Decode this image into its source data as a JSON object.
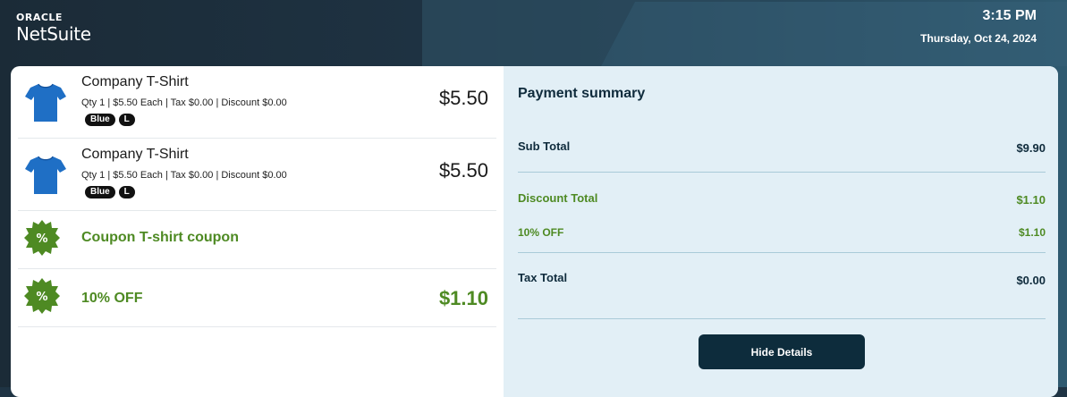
{
  "header": {
    "brand_top": "ORACLE",
    "brand_name": "NetSuite",
    "time": "3:15 PM",
    "date": "Thursday, Oct 24, 2024"
  },
  "items": [
    {
      "name": "Company T-Shirt",
      "meta": "Qty 1 | $5.50  Each | Tax $0.00 | Discount  $0.00",
      "tags": [
        "Blue",
        "L"
      ],
      "price": "$5.50",
      "icon": "tshirt-icon"
    },
    {
      "name": "Company T-Shirt",
      "meta": "Qty 1 | $5.50  Each | Tax $0.00 | Discount  $0.00",
      "tags": [
        "Blue",
        "L"
      ],
      "price": "$5.50",
      "icon": "tshirt-icon"
    }
  ],
  "coupon": {
    "label": "Coupon T-shirt coupon",
    "icon": "discount-badge-icon",
    "badge_symbol": "%"
  },
  "discount_line": {
    "label": "10% OFF",
    "amount": "$1.10",
    "icon": "discount-badge-icon",
    "badge_symbol": "%"
  },
  "summary": {
    "title": "Payment summary",
    "subtotal_label": "Sub Total",
    "subtotal_value": "$9.90",
    "discount_total_label": "Discount Total",
    "discount_total_value": "$1.10",
    "discount_detail_label": "10% OFF",
    "discount_detail_value": "$1.10",
    "tax_total_label": "Tax Total",
    "tax_total_value": "$0.00",
    "hide_button": "Hide Details"
  },
  "colors": {
    "header_bg": "#1f3444",
    "summary_bg": "#e2eff6",
    "discount_green": "#4e8a23",
    "button_bg": "#0d2c3c",
    "shirt_blue": "#1f6fc5"
  }
}
